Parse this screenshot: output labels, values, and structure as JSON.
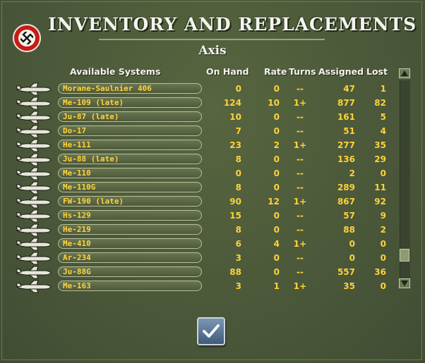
{
  "window": {
    "title": "INVENTORY AND REPLACEMENTS",
    "subtitle": "Axis"
  },
  "columns": {
    "available_systems": "Available Systems",
    "on_hand": "On Hand",
    "rate": "Rate",
    "turns": "Turns",
    "assigned": "Assigned",
    "lost": "Lost"
  },
  "rows": [
    {
      "name": "Morane-Saulnier 406",
      "on_hand": "0",
      "rate": "0",
      "turns": "--",
      "assigned": "47",
      "lost": "1"
    },
    {
      "name": "Me-109 (late)",
      "on_hand": "124",
      "rate": "10",
      "turns": "1+",
      "assigned": "877",
      "lost": "82"
    },
    {
      "name": "Ju-87 (late)",
      "on_hand": "10",
      "rate": "0",
      "turns": "--",
      "assigned": "161",
      "lost": "5"
    },
    {
      "name": "Do-17",
      "on_hand": "7",
      "rate": "0",
      "turns": "--",
      "assigned": "51",
      "lost": "4"
    },
    {
      "name": "He-111",
      "on_hand": "23",
      "rate": "2",
      "turns": "1+",
      "assigned": "277",
      "lost": "35"
    },
    {
      "name": "Ju-88 (late)",
      "on_hand": "8",
      "rate": "0",
      "turns": "--",
      "assigned": "136",
      "lost": "29"
    },
    {
      "name": "Me-110",
      "on_hand": "0",
      "rate": "0",
      "turns": "--",
      "assigned": "2",
      "lost": "0"
    },
    {
      "name": "Me-110G",
      "on_hand": "8",
      "rate": "0",
      "turns": "--",
      "assigned": "289",
      "lost": "11"
    },
    {
      "name": "FW-190 (late)",
      "on_hand": "90",
      "rate": "12",
      "turns": "1+",
      "assigned": "867",
      "lost": "92"
    },
    {
      "name": "Hs-129",
      "on_hand": "15",
      "rate": "0",
      "turns": "--",
      "assigned": "57",
      "lost": "9"
    },
    {
      "name": "He-219",
      "on_hand": "8",
      "rate": "0",
      "turns": "--",
      "assigned": "88",
      "lost": "2"
    },
    {
      "name": "Me-410",
      "on_hand": "6",
      "rate": "4",
      "turns": "1+",
      "assigned": "0",
      "lost": "0"
    },
    {
      "name": "Ar-234",
      "on_hand": "3",
      "rate": "0",
      "turns": "--",
      "assigned": "0",
      "lost": "0"
    },
    {
      "name": "Ju-88G",
      "on_hand": "88",
      "rate": "0",
      "turns": "--",
      "assigned": "557",
      "lost": "36"
    },
    {
      "name": "Me-163",
      "on_hand": "3",
      "rate": "1",
      "turns": "1+",
      "assigned": "35",
      "lost": "0"
    }
  ],
  "icons": {
    "emblem": "axis-emblem-icon",
    "row_icon": "aircraft-silhouette-icon",
    "scroll_up": "arrow-up-icon",
    "scroll_down": "arrow-down-icon",
    "confirm": "checkmark-icon"
  },
  "colors": {
    "background": "#4c5a3c",
    "value_text": "#ffd23a",
    "header_text": "#f4f4ee",
    "emblem_red": "#c81b14",
    "confirm_blue": "#5a7999"
  }
}
